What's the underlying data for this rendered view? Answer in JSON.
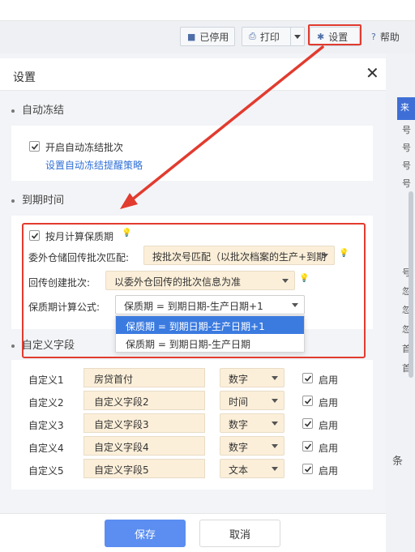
{
  "toolbar": {
    "disabled_label": "已停用",
    "print_label": "打印",
    "settings_label": "设置",
    "help_label": "帮助"
  },
  "background_right": [
    "号",
    "号",
    "号",
    "号",
    "号",
    "忽",
    "忽",
    "忽",
    "首",
    "首"
  ],
  "background_right_header": "来",
  "background_right_footer": "条",
  "dialog": {
    "title": "设置",
    "sections": {
      "auto_freeze": "自动冻结",
      "expiry": "到期时间",
      "custom": "自定义字段"
    },
    "auto_freeze": {
      "enable_label": "开启自动冻结批次",
      "strategy_link": "设置自动冻结提醒策略"
    },
    "expiry": {
      "monthly_label": "按月计算保质期",
      "outsource_match_label": "委外仓储回传批次匹配:",
      "outsource_match_value": "按批次号匹配（以批次档案的生产+到期",
      "return_create_label": "回传创建批次:",
      "return_create_value": "以委外仓回传的批次信息为准",
      "formula_label": "保质期计算公式:",
      "formula_value": "保质期 = 到期日期-生产日期+1",
      "formula_options": [
        "保质期 = 到期日期-生产日期+1",
        "保质期 = 到期日期-生产日期"
      ]
    },
    "custom_fields": [
      {
        "label": "自定义1",
        "value": "房贷首付",
        "type": "数字",
        "enabled_label": "启用"
      },
      {
        "label": "自定义2",
        "value": "自定义字段2",
        "type": "时间",
        "enabled_label": "启用"
      },
      {
        "label": "自定义3",
        "value": "自定义字段3",
        "type": "数字",
        "enabled_label": "启用"
      },
      {
        "label": "自定义4",
        "value": "自定义字段4",
        "type": "数字",
        "enabled_label": "启用"
      },
      {
        "label": "自定义5",
        "value": "自定义字段5",
        "type": "文本",
        "enabled_label": "启用"
      }
    ],
    "save_label": "保存",
    "cancel_label": "取消"
  },
  "colors": {
    "accent": "#3b7be0",
    "highlight_red": "#e23b2f",
    "field_bg": "#fcefd9",
    "link": "#2f6fd6"
  }
}
